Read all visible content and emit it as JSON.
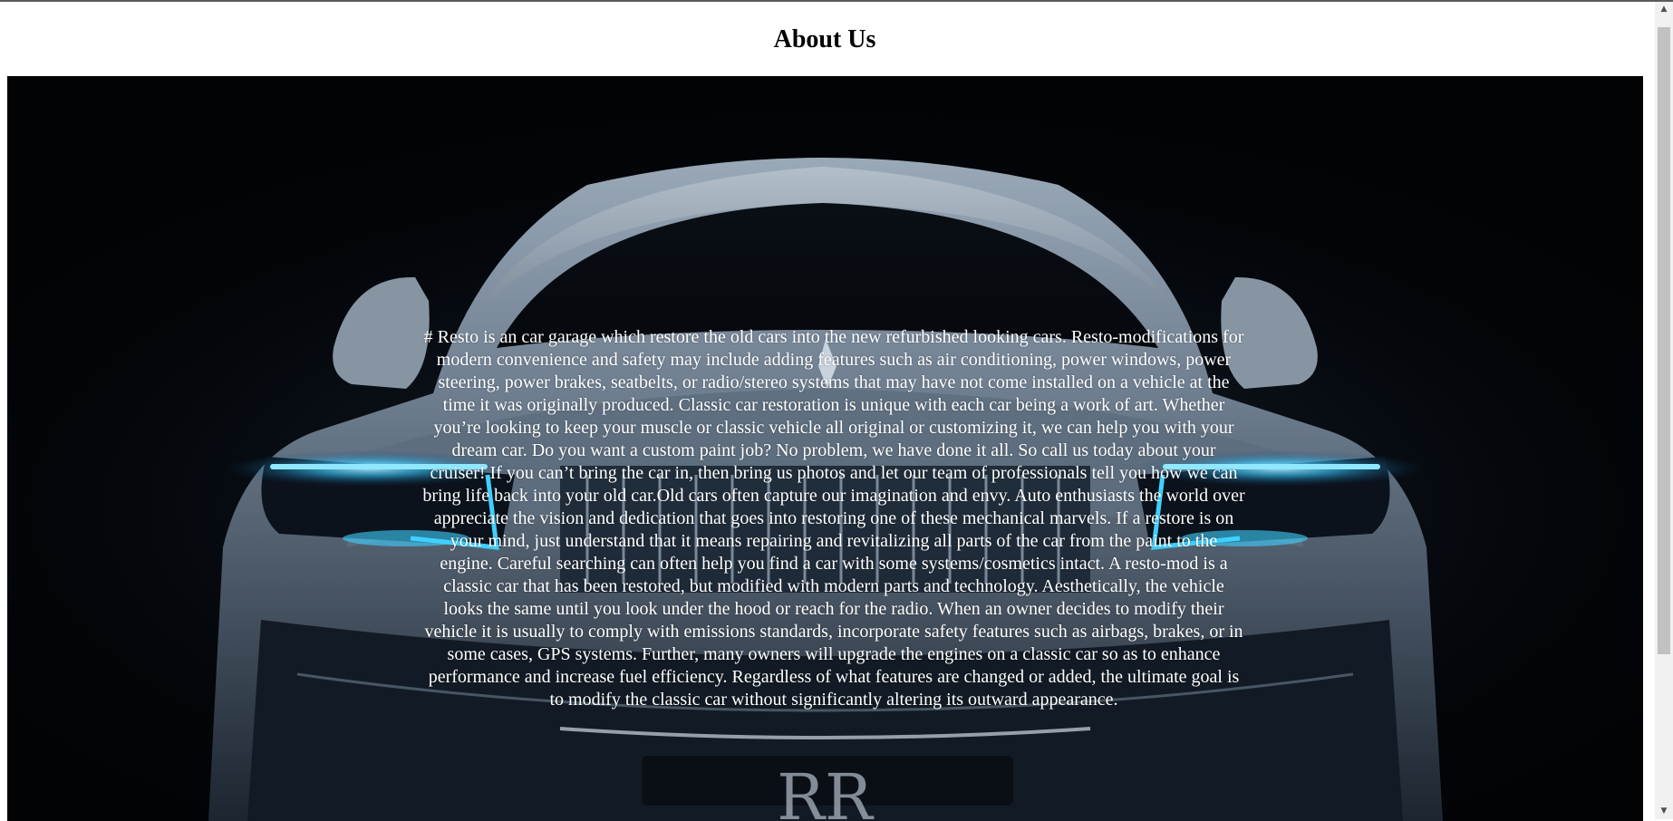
{
  "page": {
    "title": "About Us"
  },
  "hero": {
    "image_icon": "luxury-car-front-icon",
    "body_text": "# Resto is an car garage which restore the old cars into the new refurbished looking cars. Resto-modifications for modern convenience and safety may include adding features such as air conditioning, power windows, power steering, power brakes, seatbelts, or radio/stereo systems that may have not come installed on a vehicle at the time it was originally produced. Classic car restoration is unique with each car being a work of art. Whether you’re looking to keep your muscle or classic vehicle all original or customizing it, we can help you with your dream car. Do you want a custom paint job? No problem, we have done it all. So call us today about your cruiser! If you can’t bring the car in, then bring us photos and let our team of professionals tell you how we can bring life back into your old car.Old cars often capture our imagination and envy. Auto enthusiasts the world over appreciate the vision and dedication that goes into restoring one of these mechanical marvels. If a restore is on your mind, just understand that it means repairing and revitalizing all parts of the car from the paint to the engine. Careful searching can often help you find a car with some systems/cosmetics intact. A resto-mod is a classic car that has been restored, but modified with modern parts and technology. Aesthetically, the vehicle looks the same until you look under the hood or reach for the radio. When an owner decides to modify their vehicle it is usually to comply with emissions standards, incorporate safety features such as airbags, brakes, or in some cases, GPS systems. Further, many owners will upgrade the engines on a classic car so as to enhance performance and increase fuel efficiency. Regardless of what features are changed or added, the ultimate goal is to modify the classic car without significantly altering its outward appearance."
  },
  "scrollbar": {
    "up_icon": "▲",
    "down_icon": "▼"
  },
  "colors": {
    "headlight": "#3fd0ff",
    "background": "#03060a",
    "text": "#ffffff"
  }
}
